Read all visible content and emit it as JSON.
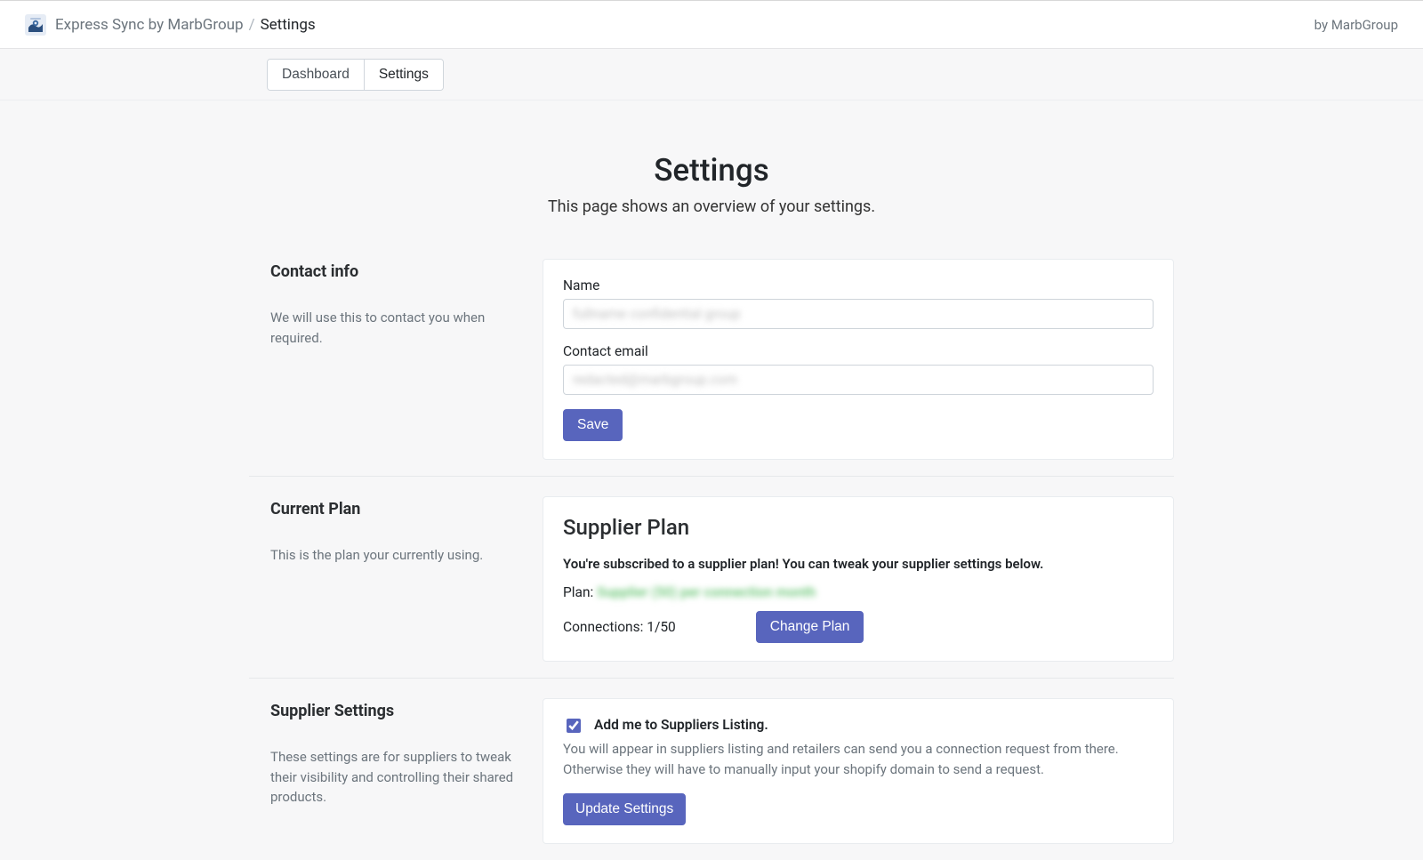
{
  "header": {
    "app_name": "Express Sync by MarbGroup",
    "separator": "/",
    "current_crumb": "Settings",
    "byline": "by MarbGroup"
  },
  "nav": {
    "tabs": [
      "Dashboard",
      "Settings"
    ],
    "active_index": 1
  },
  "page": {
    "title": "Settings",
    "subtitle": "This page shows an overview of your settings."
  },
  "contact": {
    "section_title": "Contact info",
    "section_help": "We will use this to contact you when required.",
    "name_label": "Name",
    "name_value": "fullname confidential group",
    "email_label": "Contact email",
    "email_value": "redacted@marbgroup.com",
    "save_label": "Save"
  },
  "plan": {
    "section_title": "Current Plan",
    "section_help": "This is the plan your currently using.",
    "card_title": "Supplier Plan",
    "card_desc": "You're subscribed to a supplier plan! You can tweak your supplier settings below.",
    "plan_prefix": "Plan:",
    "plan_value": "Supplier (50) per connection month",
    "connections_label": "Connections:",
    "connections_value": "1/50",
    "change_label": "Change Plan"
  },
  "supplier": {
    "section_title": "Supplier Settings",
    "section_help": "These settings are for suppliers to tweak their visibility and controlling their shared products.",
    "checkbox_label": "Add me to Suppliers Listing.",
    "checkbox_help": "You will appear in suppliers listing and retailers can send you a connection request from there. Otherwise they will have to manually input your shopify domain to send a request.",
    "update_label": "Update Settings",
    "checked": true
  }
}
